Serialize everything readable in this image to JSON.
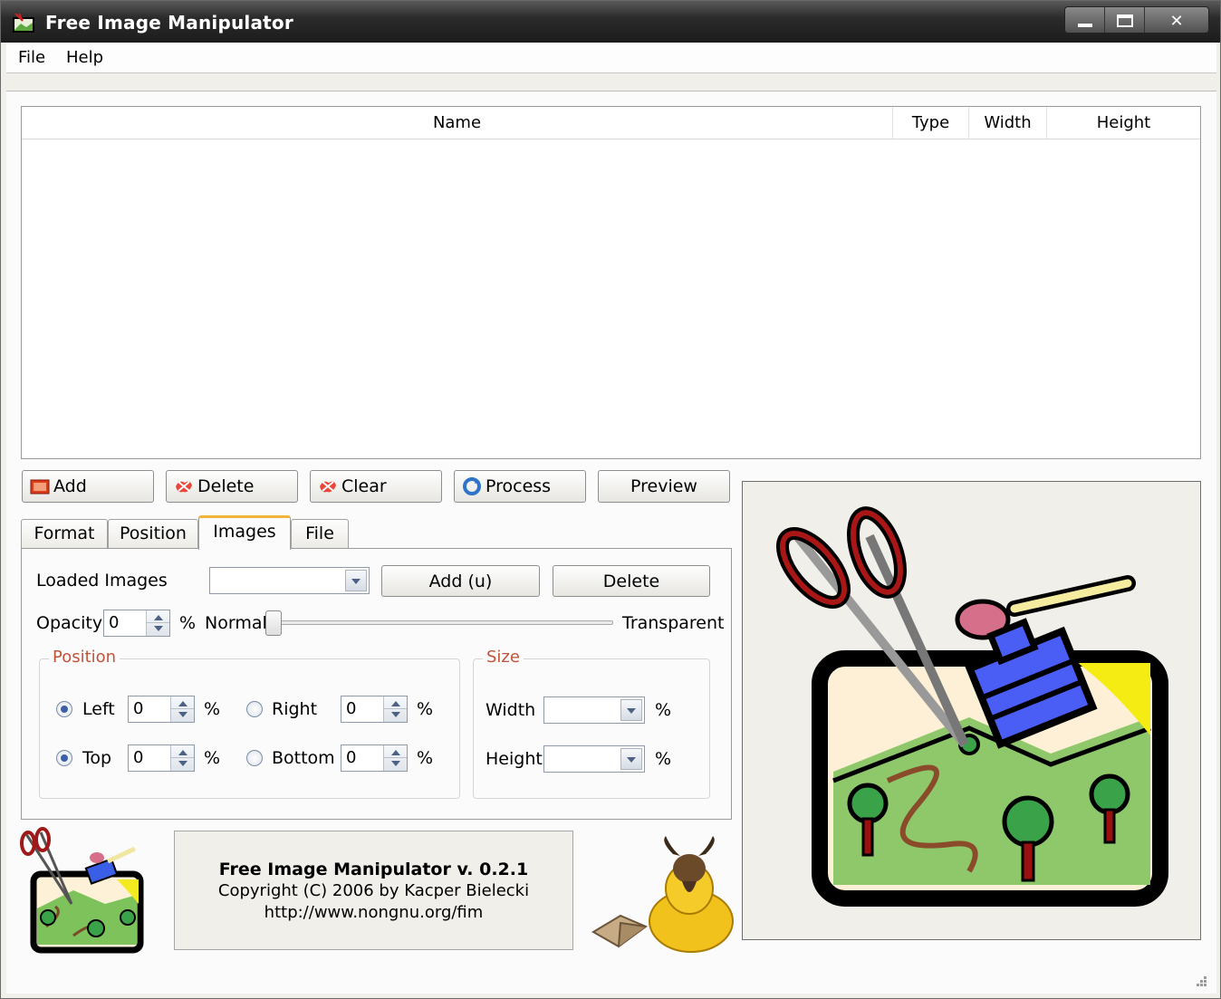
{
  "window": {
    "title": "Free Image Manipulator"
  },
  "menu": {
    "file": "File",
    "help": "Help"
  },
  "list": {
    "columns": [
      "Name",
      "Type",
      "Width",
      "Height"
    ]
  },
  "actions": {
    "add": "Add",
    "delete": "Delete",
    "clear": "Clear",
    "process": "Process",
    "preview": "Preview"
  },
  "tabs": [
    "Format",
    "Position",
    "Images",
    "File"
  ],
  "images_tab": {
    "loaded_images_label": "Loaded Images",
    "loaded_images_value": "",
    "add_u_button": "Add (u)",
    "delete_button": "Delete",
    "opacity_label": "Opacity",
    "opacity_value": "0",
    "percent": "%",
    "normal_label": "Normal",
    "transparent_label": "Transparent",
    "position_group": "Position",
    "left_label": "Left",
    "left_value": "0",
    "right_label": "Right",
    "right_value": "0",
    "top_label": "Top",
    "top_value": "0",
    "bottom_label": "Bottom",
    "bottom_value": "0",
    "size_group": "Size",
    "width_label": "Width",
    "width_value": "",
    "height_label": "Height",
    "height_value": ""
  },
  "about": {
    "title": "Free Image Manipulator v. 0.2.1",
    "copyright": "Copyright (C) 2006 by Kacper Bielecki",
    "url": "http://www.nongnu.org/fim"
  },
  "icons": [
    "app-icon",
    "minimize-icon",
    "maximize-icon",
    "close-icon",
    "add-icon",
    "delete-icon",
    "clear-icon",
    "process-icon",
    "logo-image",
    "gnu-mascot-image",
    "preview-image"
  ]
}
